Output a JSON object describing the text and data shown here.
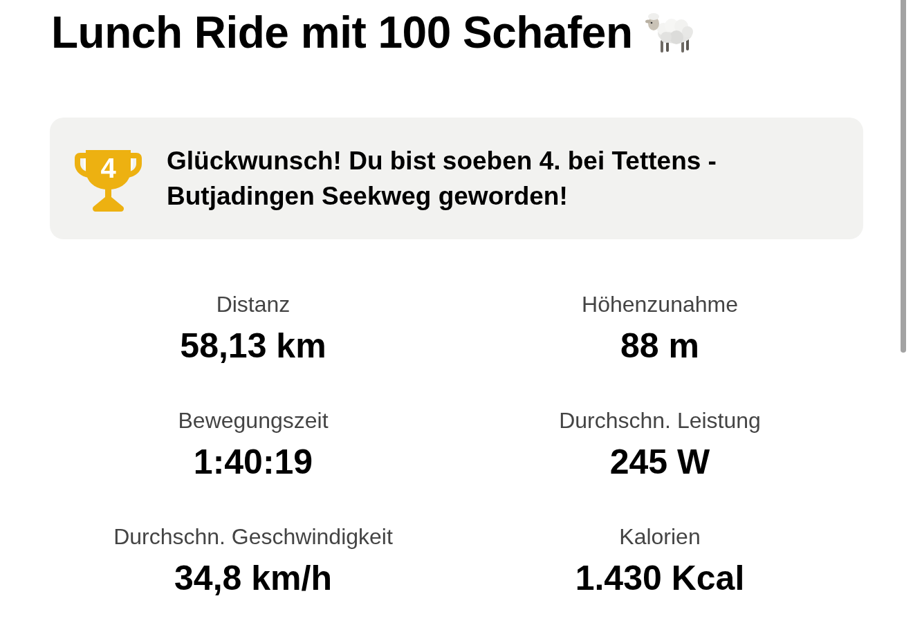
{
  "title": "Lunch Ride mit 100 Schafen",
  "achievement": {
    "rank": "4",
    "message": "Glückwunsch! Du bist soeben 4. bei Tettens - Butjadingen Seekweg geworden!"
  },
  "stats": [
    {
      "label": "Distanz",
      "value": "58,13 km"
    },
    {
      "label": "Höhenzunahme",
      "value": "88 m"
    },
    {
      "label": "Bewegungszeit",
      "value": "1:40:19"
    },
    {
      "label": "Durchschn. Leistung",
      "value": "245 W"
    },
    {
      "label": "Durchschn. Geschwindigkeit",
      "value": "34,8 km/h"
    },
    {
      "label": "Kalorien",
      "value": "1.430 Kcal"
    }
  ]
}
